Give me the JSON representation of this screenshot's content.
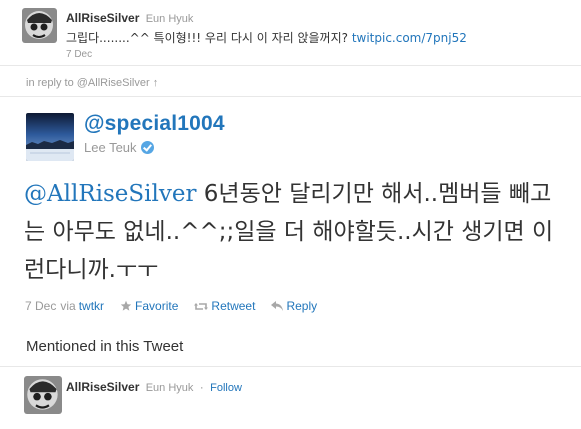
{
  "parent_tweet": {
    "screen_name": "AllRiseSilver",
    "full_name": "Eun Hyuk",
    "text": "그립다........^^ 특이형!!! 우리 다시 이 자리 앉을꺼지? ",
    "link": "twitpic.com/7pnj52",
    "date": "7 Dec"
  },
  "in_reply_to": "in reply to @AllRiseSilver ↑",
  "main_tweet": {
    "screen_name": "@special1004",
    "full_name": "Lee Teuk",
    "verified": true,
    "mention": "@AllRiseSilver",
    "text": " 6년동안 달리기만 해서..멤버들 빼고는 아무도 없네..^^;;일을 더 해야할듯..시간 생기면 이런다니까.ㅜㅜ",
    "date": "7 Dec",
    "via_label": "via",
    "source": "twtkr",
    "actions": {
      "favorite": "Favorite",
      "retweet": "Retweet",
      "reply": "Reply"
    }
  },
  "mentioned": {
    "title": "Mentioned in this Tweet",
    "user": {
      "screen_name": "AllRiseSilver",
      "full_name": "Eun Hyuk",
      "follow": "Follow"
    }
  },
  "colors": {
    "link": "#2276bb",
    "muted": "#999999",
    "text": "#333333",
    "verified": "#56a6e4"
  }
}
